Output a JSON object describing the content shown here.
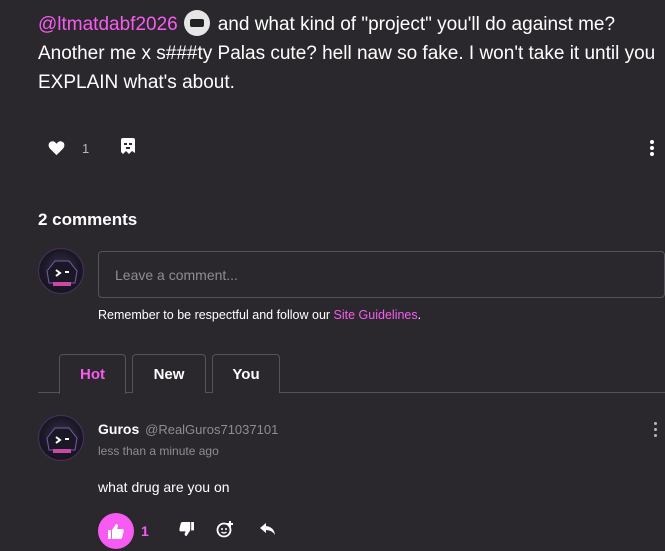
{
  "post": {
    "mention": "@ltmatdabf2026",
    "text": "and what kind of \"project\" you'll do against me? Another me x s###ty Palas cute? hell naw so fake. I won't take it until you EXPLAIN what's about.",
    "like_count": "1"
  },
  "comments": {
    "title": "2 comments",
    "input_placeholder": "Leave a comment...",
    "guidelines_prefix": "Remember to be respectful and follow our ",
    "guidelines_link": "Site Guidelines",
    "guidelines_suffix": ".",
    "tabs": [
      "Hot",
      "New",
      "You"
    ]
  },
  "comment": {
    "username": "Guros",
    "handle": "@RealGuros71037101",
    "time": "less than a minute ago",
    "text": "what drug are you on",
    "like_count": "1"
  },
  "colors": {
    "accent": "#f85bf2",
    "background": "#2a282d",
    "border": "#55525a"
  },
  "icons": [
    "heart-icon",
    "dislike-ghost-icon",
    "more-vert-icon",
    "thumbs-up-icon",
    "thumbs-down-icon",
    "add-reaction-icon",
    "reply-icon"
  ]
}
